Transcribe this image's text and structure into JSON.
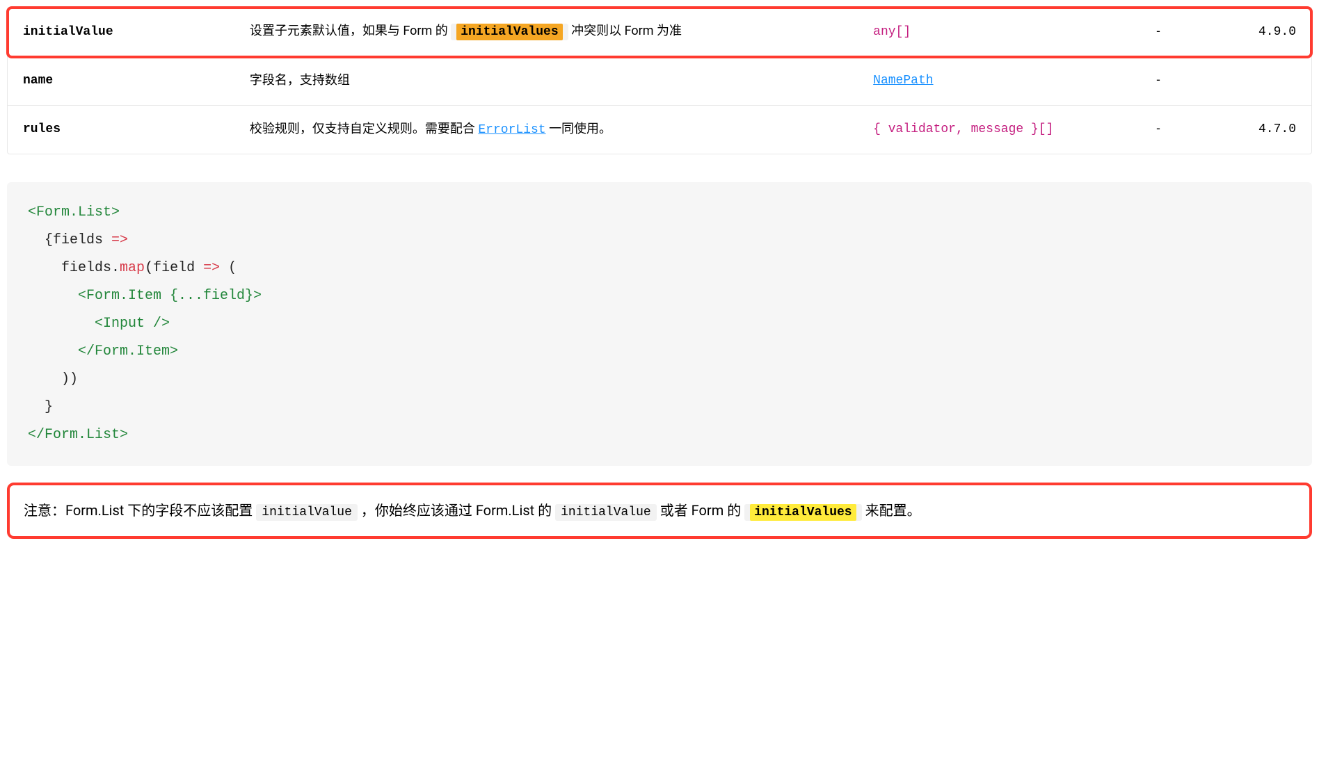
{
  "table": {
    "rows": [
      {
        "prop": "initialValue",
        "desc_parts": {
          "p1": "设置子元素默认值，如果与 Form 的 ",
          "hl": "initialValues",
          "p2": " 冲突则以 Form 为准"
        },
        "type": "any[]",
        "default": "-",
        "version": "4.9.0",
        "highlighted": true
      },
      {
        "prop": "name",
        "desc_plain": "字段名，支持数组",
        "type_link": "NamePath",
        "default": "-",
        "version": ""
      },
      {
        "prop": "rules",
        "desc_rules": {
          "p1": "校验规则，仅支持自定义规则。需要配合 ",
          "link": "ErrorList",
          "p2": " 一同使用。"
        },
        "type": "{ validator, message }[]",
        "default": "-",
        "version": "4.7.0"
      }
    ]
  },
  "code": {
    "l1_open": "<Form.List>",
    "l2a": "  {fields ",
    "l2b": "=>",
    "l3a": "    fields",
    "l3dot": ".",
    "l3m": "map",
    "l3b": "(field ",
    "l3c": "=>",
    "l3d": " (",
    "l4": "      <Form.Item {...field}>",
    "l5": "        <Input />",
    "l6": "      </Form.Item>",
    "l7": "    ))",
    "l8": "  }",
    "l9": "</Form.List>"
  },
  "note": {
    "p1": "注意：Form.List 下的字段不应该配置 ",
    "c1": "initialValue",
    "p2": " ，你始终应该通过 Form.List 的 ",
    "c2": "initialValue",
    "p3": " 或者 Form 的 ",
    "c3": "initialValues",
    "p4": " 来配置。"
  }
}
